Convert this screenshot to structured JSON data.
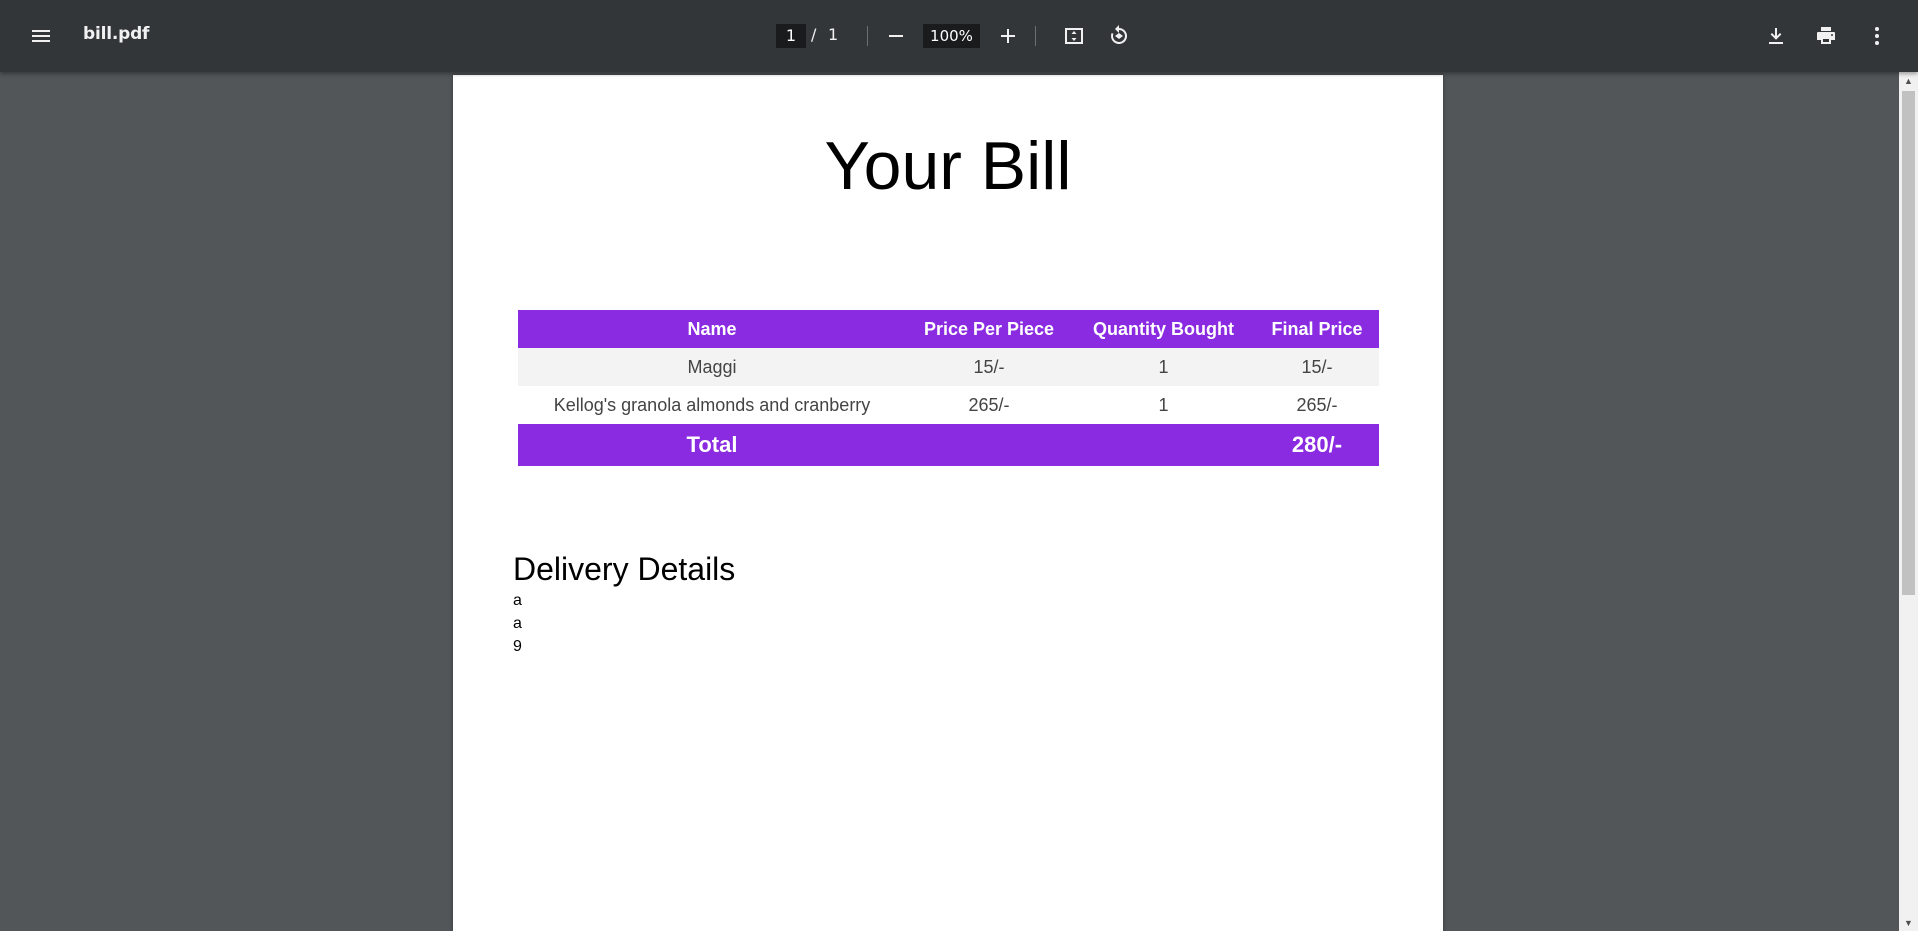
{
  "toolbar": {
    "title": "bill.pdf",
    "current_page": "1",
    "page_separator": "/",
    "total_pages": "1",
    "zoom": "100%"
  },
  "document": {
    "title": "Your Bill",
    "table": {
      "headers": [
        "Name",
        "Price Per Piece",
        "Quantity Bought",
        "Final Price"
      ],
      "rows": [
        [
          "Maggi",
          "15/-",
          "1",
          "15/-"
        ],
        [
          "Kellog's granola almonds and cranberry",
          "265/-",
          "1",
          "265/-"
        ]
      ],
      "total_label": "Total",
      "total_value": "280/-"
    },
    "delivery": {
      "heading": "Delivery Details",
      "lines": [
        "a",
        "a",
        "9"
      ]
    }
  },
  "colors": {
    "accent": "#8a2be2",
    "toolbar_bg": "#323639",
    "viewer_bg": "#525659"
  }
}
